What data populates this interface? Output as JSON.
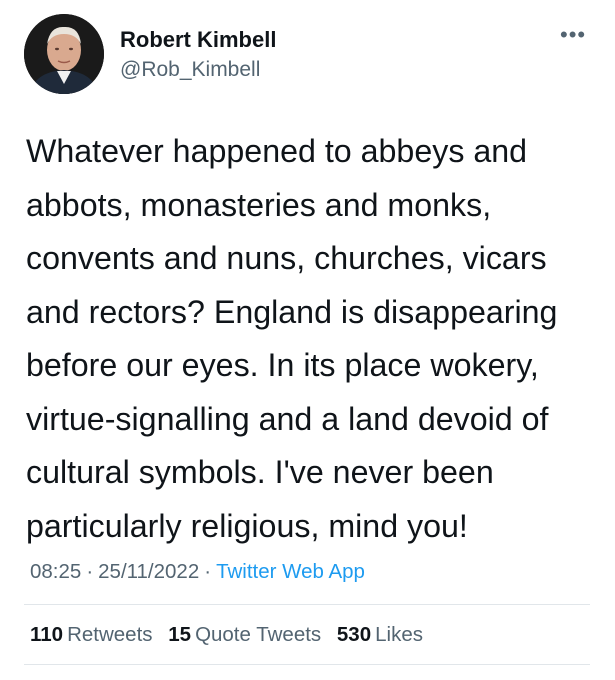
{
  "author": {
    "name": "Robert Kimbell",
    "handle": "@Rob_Kimbell",
    "avatar_icon": "profile-photo"
  },
  "more_icon": "more-options-icon",
  "more_glyph": "•••",
  "tweet": {
    "text": "Whatever happened to abbeys and\nabbots, monasteries and monks,\nconvents and nuns, churches, vicars\nand rectors? England is disappearing\nbefore our eyes. In its place wokery,\nvirtue-signalling and a land devoid of\ncultural symbols. I've never been\nparticularly religious, mind you!"
  },
  "meta": {
    "time": "08:25",
    "separator": "·",
    "date": "25/11/2022",
    "app": "Twitter Web App"
  },
  "stats": {
    "retweets_count": "110",
    "retweets_label": "Retweets",
    "quotes_count": "15",
    "quotes_label": "Quote Tweets",
    "likes_count": "530",
    "likes_label": "Likes"
  },
  "colors": {
    "text": "#0f1419",
    "secondary": "#536471",
    "link": "#1d9bf0",
    "divider": "#e1e6ea"
  }
}
